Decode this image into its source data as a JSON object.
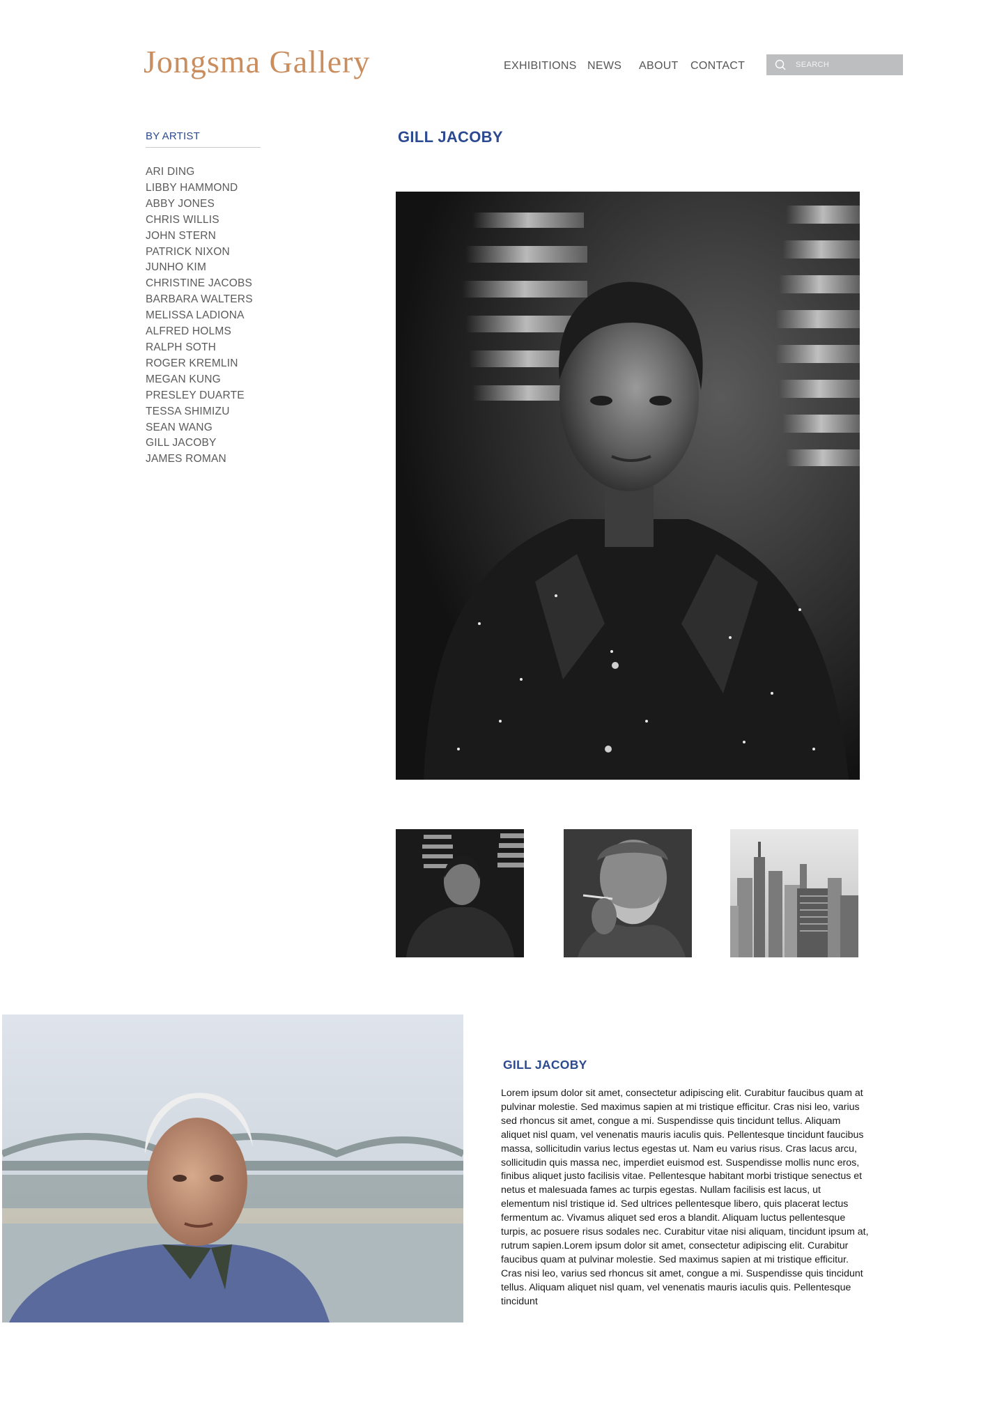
{
  "header": {
    "logo": "Jongsma Gallery",
    "nav": [
      "EXHIBITIONS",
      "NEWS",
      "ABOUT",
      "CONTACT"
    ],
    "search_placeholder": "SEARCH"
  },
  "sidebar": {
    "heading": "BY ARTIST",
    "artists": [
      "ARI DING",
      "LIBBY HAMMOND",
      "ABBY JONES",
      "CHRIS WILLIS",
      "JOHN STERN",
      "PATRICK NIXON",
      "JUNHO KIM",
      "CHRISTINE JACOBS",
      "BARBARA WALTERS",
      "MELISSA LADIONA",
      "ALFRED HOLMS",
      "RALPH SOTH",
      "ROGER KREMLIN",
      "MEGAN KUNG",
      "PRESLEY DUARTE",
      "TESSA SHIMIZU",
      "SEAN WANG",
      "GILL JACOBY",
      "JAMES ROMAN"
    ]
  },
  "main": {
    "artist_name": "GILL JACOBY",
    "thumbnails": [
      "portrait-man-window-shadows",
      "elderly-man-smoking",
      "city-skyline"
    ]
  },
  "bio": {
    "title": "GILL JACOBY",
    "text": "Lorem ipsum dolor sit amet, consectetur adipiscing elit. Curabitur faucibus quam at pulvinar molestie. Sed maximus sapien at mi tristique efficitur. Cras nisi leo, varius sed rhoncus sit amet, congue a mi. Suspendisse quis tincidunt tellus. Aliquam aliquet nisl quam, vel venenatis mauris iaculis quis. Pellentesque tincidunt faucibus massa, sollicitudin varius lectus egestas ut. Nam eu varius risus. Cras lacus arcu, sollicitudin quis massa nec, imperdiet euismod est. Suspendisse mollis nunc eros, finibus aliquet justo facilisis vitae. Pellentesque habitant morbi tristique senectus et netus et malesuada fames ac turpis egestas. Nullam facilisis est lacus, ut elementum nisl tristique id. Sed ultrices pellentesque libero, quis placerat lectus fermentum ac. Vivamus aliquet sed eros a blandit. Aliquam luctus pellentesque turpis, ac posuere risus sodales nec. Curabitur vitae nisi aliquam, tincidunt ipsum at, rutrum sapien.Lorem ipsum dolor sit amet, consectetur adipiscing elit. Curabitur faucibus quam at pulvinar molestie. Sed maximus sapien at mi tristique efficitur. Cras nisi leo, varius sed rhoncus sit amet, congue a mi. Suspendisse quis tincidunt tellus. Aliquam aliquet nisl quam, vel venenatis mauris iaculis quis. Pellentesque tincidunt"
  },
  "colors": {
    "logo": "#c98d5e",
    "accent_blue": "#2b4a8f",
    "nav_text": "#555555",
    "search_bg": "#bdbebf"
  }
}
